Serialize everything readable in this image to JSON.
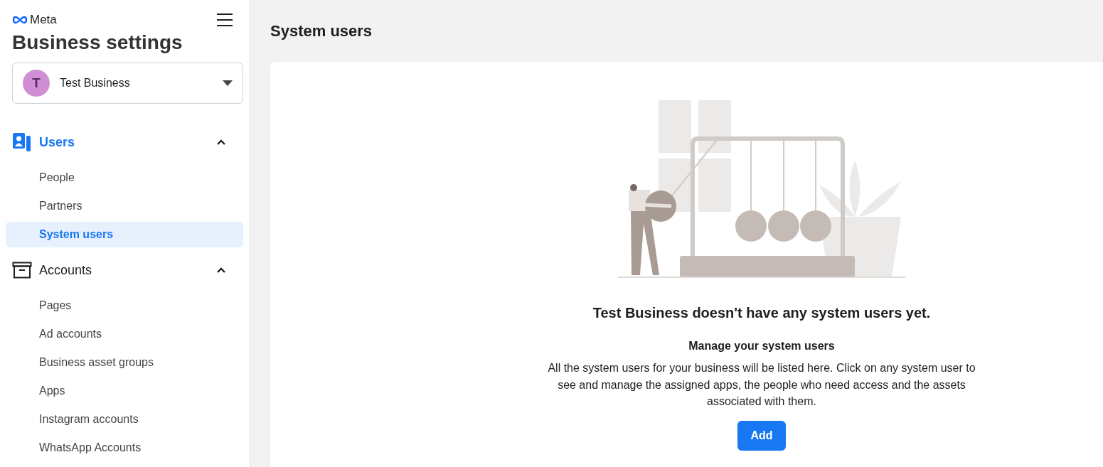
{
  "brand": "Meta",
  "title": "Business settings",
  "business": {
    "initial": "T",
    "name": "Test Business"
  },
  "nav": [
    {
      "label": "Users",
      "kind": "users",
      "selected": true,
      "expanded": true,
      "children": [
        {
          "label": "People",
          "selected": false
        },
        {
          "label": "Partners",
          "selected": false
        },
        {
          "label": "System users",
          "selected": true
        }
      ]
    },
    {
      "label": "Accounts",
      "kind": "accounts",
      "selected": false,
      "expanded": true,
      "children": [
        {
          "label": "Pages",
          "selected": false
        },
        {
          "label": "Ad accounts",
          "selected": false
        },
        {
          "label": "Business asset groups",
          "selected": false
        },
        {
          "label": "Apps",
          "selected": false
        },
        {
          "label": "Instagram accounts",
          "selected": false
        },
        {
          "label": "WhatsApp Accounts",
          "selected": false
        }
      ]
    }
  ],
  "page_title": "System users",
  "empty_state": {
    "heading": "Test Business doesn't have any system users yet.",
    "subheading": "Manage your system users",
    "body": "All the system users for your business will be listed here. Click on any system user to see and manage the assigned apps, the people who need access and the assets associated with them.",
    "button": "Add"
  }
}
